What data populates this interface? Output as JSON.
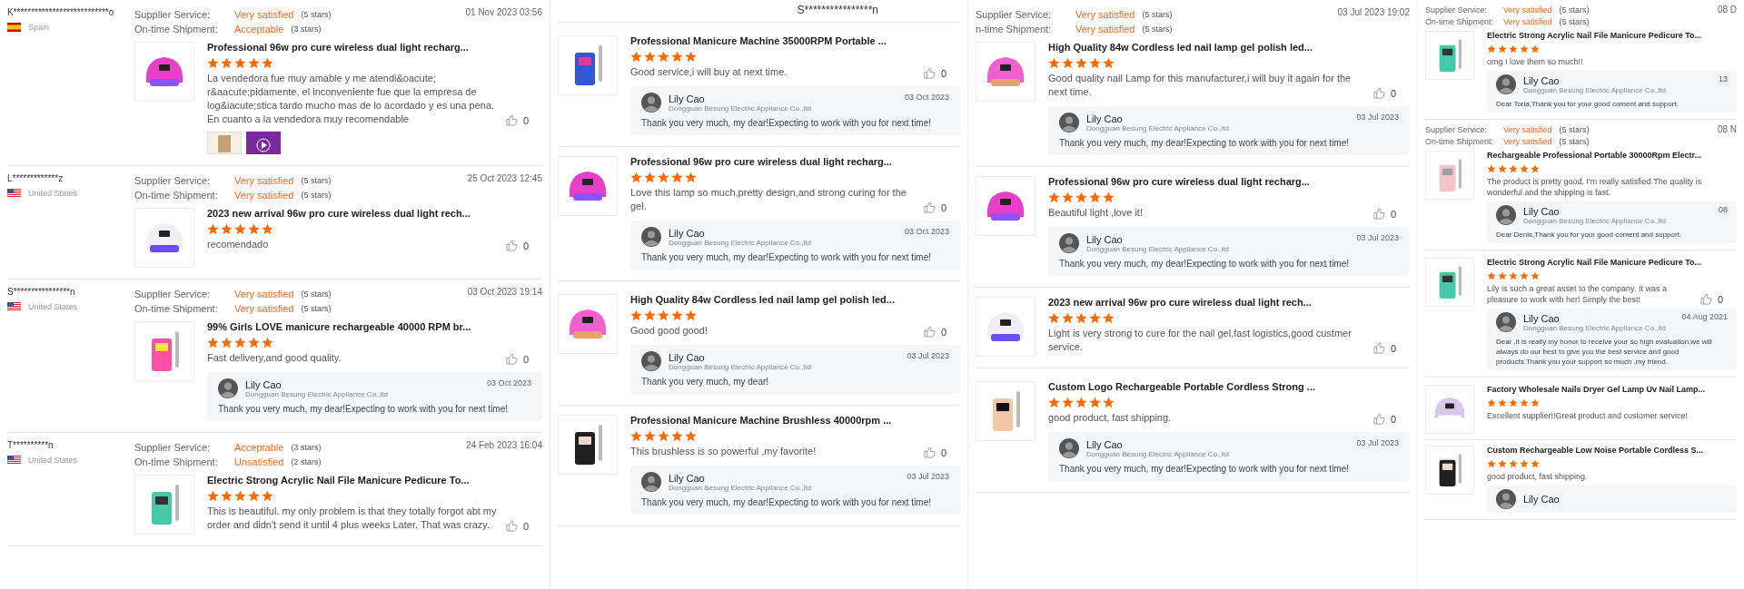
{
  "columns": [
    {
      "blocks": [
        {
          "buyer": {
            "name": "K***************************o",
            "country": "Spain",
            "kind": "spain"
          },
          "ratings": [
            {
              "label": "Supplier Service:",
              "value": "Very satisfied",
              "note": "(5 stars)"
            },
            {
              "label": "On-time Shipment:",
              "value": "Acceptable",
              "note": "(3 stars)"
            }
          ],
          "date": "01 Nov 2023 03:56",
          "items": [
            {
              "kind": "pink-lamp",
              "title": "Professional 96w pro cure wireless dual light recharg...",
              "stars": 5,
              "comment": "La vendedora fue muy amable y me atendi&oacute; r&aacute;pidamente, el inconveniente fue que la empresa de log&iacute;stica tardo mucho mas de lo acordado y es una pena. En cuanto a la vendedora muy recomendable",
              "likes": "0",
              "media": [
                {
                  "kind": "photo"
                },
                {
                  "kind": "video"
                }
              ]
            }
          ]
        },
        {
          "buyer": {
            "name": "L*************z",
            "country": "United States",
            "kind": "usa"
          },
          "ratings": [
            {
              "label": "Supplier Service:",
              "value": "Very satisfied",
              "note": "(5 stars)"
            },
            {
              "label": "On-time Shipment:",
              "value": "Very satisfied",
              "note": "(5 stars)"
            }
          ],
          "date": "25 Oct 2023 12:45",
          "items": [
            {
              "kind": "white-lamp",
              "title": "2023 new arrival 96w pro cure wireless dual light rech...",
              "stars": 5,
              "comment": "recomendado",
              "likes": "0"
            }
          ]
        },
        {
          "buyer": {
            "name": "S****************n",
            "country": "United States",
            "kind": "usa"
          },
          "ratings": [
            {
              "label": "Supplier Service:",
              "value": "Very satisfied",
              "note": "(5 stars)"
            },
            {
              "label": "On-time Shipment:",
              "value": "Very satisfied",
              "note": "(5 stars)"
            }
          ],
          "date": "03 Oct 2023 19:14",
          "items": [
            {
              "kind": "gradient-drill",
              "title": "99% Girls LOVE manicure rechargeable 40000 RPM br...",
              "stars": 5,
              "comment": "Fast delivery,and good quality.",
              "likes": "0",
              "reply": {
                "name": "Lily Cao",
                "company": "Dongguan Besung Electric Appliance Co.,ltd",
                "date": "03 Oct 2023",
                "text": "Thank you very much, my dear!Expecting to work with you for next time!"
              }
            }
          ]
        },
        {
          "buyer": {
            "name": "T**********n",
            "country": "United States",
            "kind": "usa"
          },
          "ratings": [
            {
              "label": "Supplier Service:",
              "value": "Acceptable",
              "note": "(3 stars)"
            },
            {
              "label": "On-time Shipment:",
              "value": "Unsatisfied",
              "note": "(2 stars)"
            }
          ],
          "date": "24 Feb 2023 16:04",
          "items": [
            {
              "kind": "teal-drill",
              "title": "Electric Strong Acrylic Nail File Manicure Pedicure To...",
              "stars": 5,
              "comment": "This is beautiful. my only problem is that they totally forgot abt my order and didn't send it until 4 plus weeks Later. That was crazy.",
              "likes": "0"
            }
          ]
        }
      ]
    },
    {
      "header": "S****************n",
      "blocks": [
        {
          "items": [
            {
              "kind": "blue-drill",
              "title": "Professional Manicure Machine 35000RPM Portable ...",
              "stars": 5,
              "comment": "Good service,i will buy at next time.",
              "likes": "0",
              "reply": {
                "name": "Lily Cao",
                "company": "Dongguan Besung Electric Appliance Co.,ltd",
                "date": "03 Oct 2023",
                "text": "Thank you very much, my dear!Expecting to work with you for next time!"
              }
            },
            {
              "kind": "pink-lamp",
              "title": "Professional 96w pro cure wireless dual light recharg...",
              "stars": 5,
              "comment": "Love this lamp so much,pretty design,and strong curing for the gel.",
              "likes": "0",
              "reply": {
                "name": "Lily Cao",
                "company": "Dongguan Besung Electric Appliance Co.,ltd",
                "date": "03 Oct 2023",
                "text": "Thank you very much, my dear!Expecting to work with you for next time!"
              }
            }
          ]
        },
        {
          "items": [
            {
              "kind": "bag-lamp",
              "title": "High Quality 84w Cordless led nail lamp gel polish led...",
              "stars": 5,
              "comment": "Good good good!",
              "likes": "0",
              "reply": {
                "name": "Lily Cao",
                "company": "Dongguan Besung Electric Appliance Co.,ltd",
                "date": "03 Jul 2023",
                "text": "Thank you very much, my dear!"
              }
            },
            {
              "kind": "black-drill",
              "title": "Professional Manicure Machine Brushless 40000rpm ...",
              "stars": 5,
              "comment": "This brushless is so powerful ,my favorite!",
              "likes": "0",
              "reply": {
                "name": "Lily Cao",
                "company": "Dongguan Besung Electric Appliance Co.,ltd",
                "date": "03 Jul 2023",
                "text": "Thank you very much, my dear!Expecting to work with you for next time!"
              }
            }
          ]
        }
      ]
    },
    {
      "blocks": [
        {
          "ratings": [
            {
              "label": "Supplier Service:",
              "value": "Very satisfied",
              "note": "(5 stars)"
            },
            {
              "label": "n-time Shipment:",
              "value": "Very satisfied",
              "note": "(5 stars)"
            }
          ],
          "date": "03 Jul 2023 19:02",
          "items": [
            {
              "kind": "bag-lamp",
              "title": "High Quality 84w Cordless led nail lamp gel polish led...",
              "stars": 5,
              "comment": "Good quality nail Lamp for this manufacturer,i will buy it again for the next time.",
              "likes": "0",
              "reply": {
                "name": "Lily Cao",
                "company": "Dongguan Besung Electric Appliance Co.,ltd",
                "date": "03 Jul 2023",
                "text": "Thank you very much, my dear!Expecting to work with you for next time!"
              }
            },
            {
              "kind": "pink-lamp",
              "title": "Professional 96w pro cure wireless dual light recharg...",
              "stars": 5,
              "comment": "Beautiful light ,love it!",
              "likes": "0",
              "reply": {
                "name": "Lily Cao",
                "company": "Dongguan Besung Electric Appliance Co.,ltd",
                "date": "03 Jul 2023",
                "text": "Thank you very much, my dear!Expecting to work with you for next time!"
              }
            },
            {
              "kind": "white-lamp",
              "title": "2023 new arrival 96w pro cure wireless dual light rech...",
              "stars": 5,
              "comment": "Light is very strong to cure for the nail gel,fast logistics,good custmer service.",
              "likes": "0"
            }
          ]
        },
        {
          "items": [
            {
              "kind": "peach-drill",
              "title": "Custom Logo Rechargeable Portable Cordless Strong ...",
              "stars": 5,
              "comment": "good product, fast shipping.",
              "likes": "0",
              "reply": {
                "name": "Lily Cao",
                "company": "Dongguan Besung Electric Appliance Co.,ltd",
                "date": "03 Jul 2023",
                "text": "Thank you very much, my dear!Expecting to work with you for next time!"
              }
            }
          ]
        }
      ]
    },
    {
      "blocks": [
        {
          "ratings": [
            {
              "label": "Supplier Service:",
              "value": "Very satisfied",
              "note": "(5 stars)"
            },
            {
              "label": "On-time Shipment:",
              "value": "Very satisfied",
              "note": "(5 stars)"
            }
          ],
          "date": "08 D",
          "items": [
            {
              "kind": "teal-drill",
              "title": "Electric Strong Acrylic Nail File Manicure Pedicure To...",
              "stars": 5,
              "comment": "omg I love them so much!!",
              "reply": {
                "name": "Lily Cao",
                "company": "Dongguan Besung Electric Appliance Co.,ltd",
                "date": "13",
                "text": "Dear Toria,Thank you for your good coment and support."
              }
            }
          ]
        },
        {
          "ratings": [
            {
              "label": "Supplier Service:",
              "value": "Very satisfied",
              "note": "(5 stars)"
            },
            {
              "label": "On-time Shipment:",
              "value": "Very satisfied",
              "note": "(5 stars)"
            }
          ],
          "date": "08 N",
          "items": [
            {
              "kind": "pink-drill",
              "title": "Rechargeable Professional Portable 30000Rpm Electr...",
              "stars": 5,
              "comment": "The product is pretty good. I'm really satisfied.The quality is wonderful and the shipping is fast.",
              "reply": {
                "name": "Lily Cao",
                "company": "Dongguan Besung Electric Appliance Co.,ltd",
                "date": "08",
                "text": "Dear Denis,Thank you for your good coment and support."
              }
            }
          ]
        },
        {
          "items": [
            {
              "kind": "teal-drill",
              "title": "Electric Strong Acrylic Nail File Manicure Pedicure To...",
              "stars": 5,
              "comment": "Lily is such a great asset to the company. It was a pleasure to work with her! Simply the best!",
              "likes": "0",
              "reply": {
                "name": "Lily Cao",
                "company": "Dongguan Besung Electric Appliance Co.,ltd",
                "date": "04 Aug 2021",
                "text": "Dear ,it is really my honor to receive your so high evaluation,we will always do our best to give you the best service and good products.Thank you your support so much ,my friend."
              }
            }
          ]
        },
        {
          "items": [
            {
              "kind": "lilac-lamp",
              "title": "Factory Wholesale Nails Dryer Gel Lamp Uv Nail Lamp...",
              "stars": 5,
              "comment": "Excellent supplier!!Great product and customer service!"
            },
            {
              "kind": "black-drill",
              "title": "Custom Rechargeable Low Noise Portable Cordless S...",
              "stars": 5,
              "comment": "good product, fast shipping.",
              "reply": {
                "name": "Lily Cao"
              }
            }
          ]
        }
      ]
    }
  ]
}
